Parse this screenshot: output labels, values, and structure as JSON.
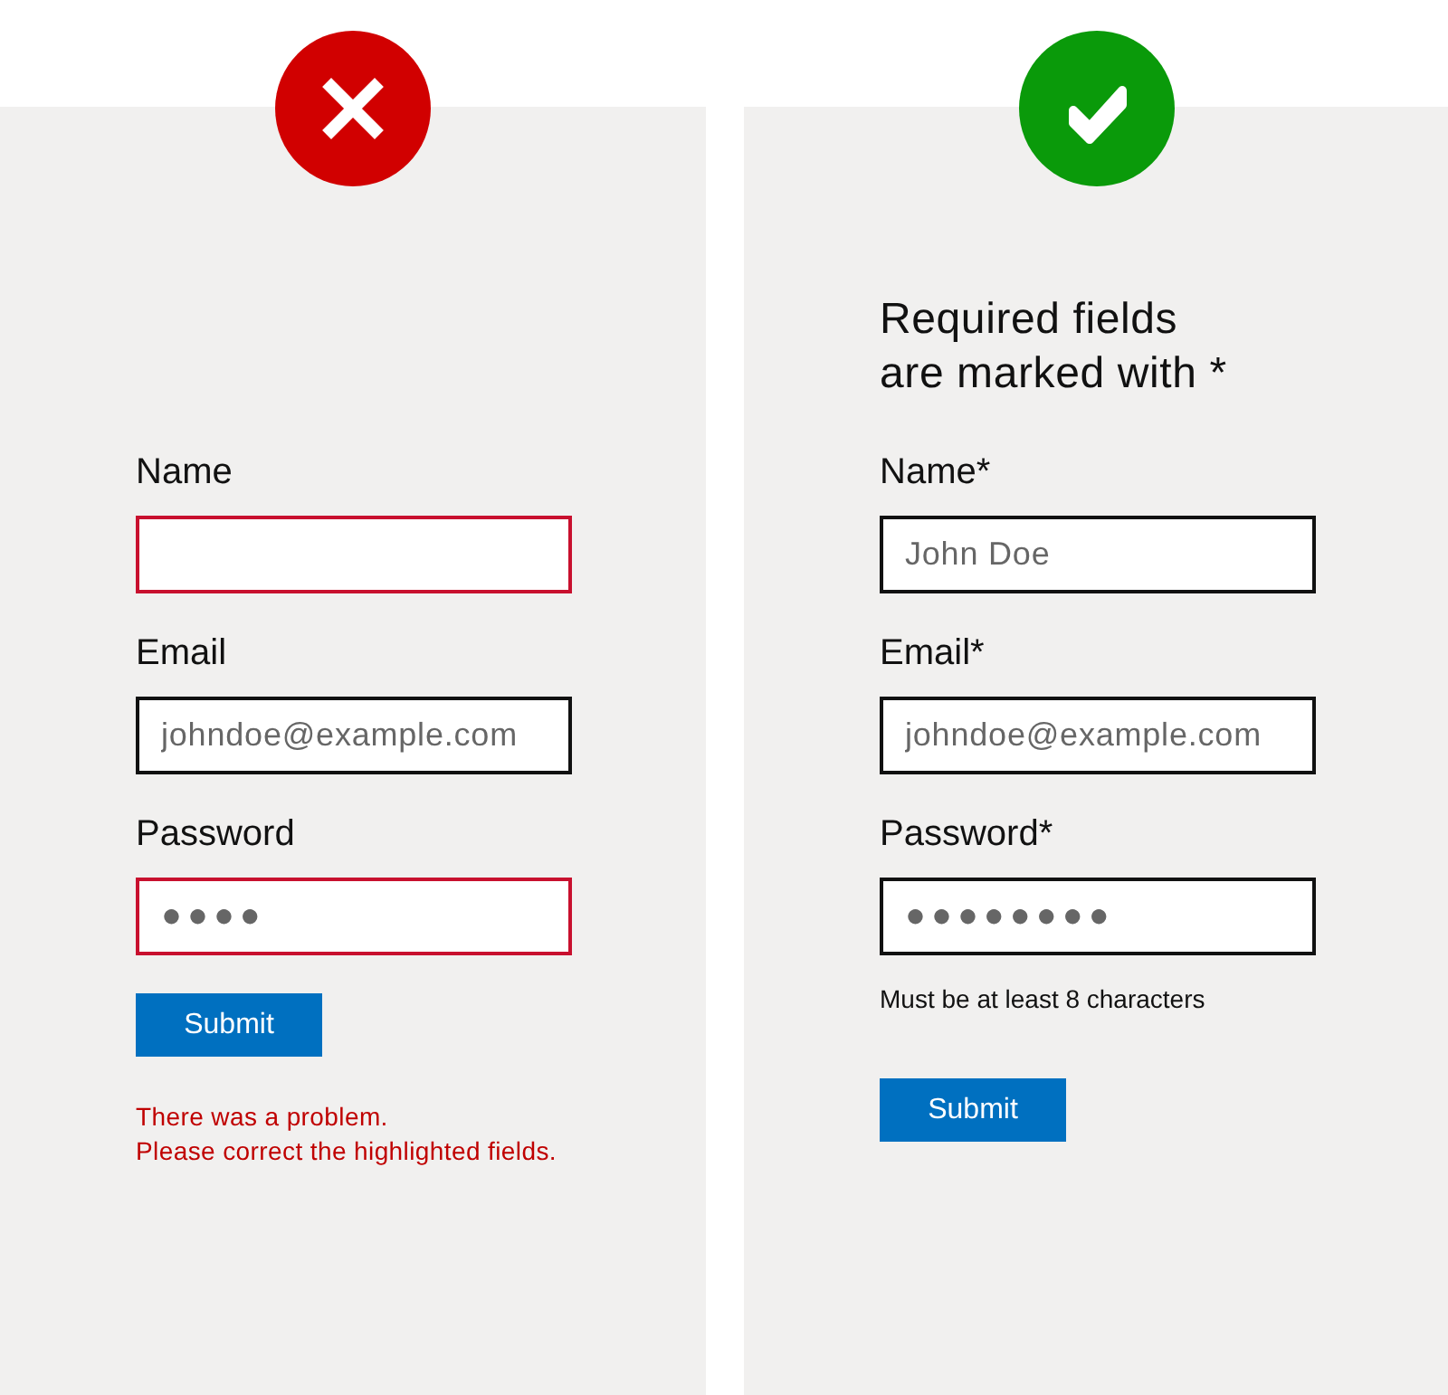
{
  "panels": [
    {
      "kind": "wrong",
      "fields": [
        {
          "label": "Name",
          "error": true
        },
        {
          "label": "Email",
          "placeholder": "johndoe@example.com",
          "error": false
        },
        {
          "label": "Password",
          "value": "●●●●",
          "error": true
        }
      ],
      "button": "Submit",
      "message": [
        "There was a problem.",
        "Please correct the highlighted fields."
      ]
    },
    {
      "kind": "right",
      "heading": [
        "Required fields",
        "are marked with *"
      ],
      "fields": [
        {
          "label": "Name*",
          "placeholder": "John Doe",
          "error": false
        },
        {
          "label": "Email*",
          "placeholder": "johndoe@example.com",
          "error": false
        },
        {
          "label": "Password*",
          "value": "●●●●●●●●",
          "error": false,
          "hint": "Must be at least 8 characters"
        }
      ],
      "button": "Submit"
    }
  ]
}
